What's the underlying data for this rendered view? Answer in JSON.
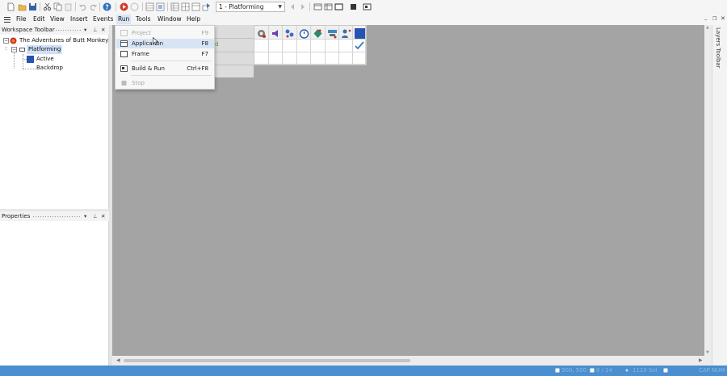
{
  "toolbar": {
    "frame_select_value": "1 - Platforming",
    "icons": [
      "new-file-icon",
      "open-folder-icon",
      "save-icon",
      "cut-icon",
      "copy-icon",
      "paste-icon",
      "undo-icon",
      "redo-icon",
      "help-icon",
      "run-icon",
      "stop-icon",
      "storyboard-icon",
      "frame-editor-icon",
      "event-editor-icon",
      "event-list-icon",
      "data-elements-icon",
      "pointer-icon",
      "previous-frame-icon",
      "next-frame-icon"
    ]
  },
  "menubar": {
    "items": [
      "File",
      "Edit",
      "View",
      "Insert",
      "Events",
      "Run",
      "Tools",
      "Window",
      "Help"
    ],
    "open_item": "Run"
  },
  "workspace": {
    "title": "Workspace Toolbar",
    "tree": {
      "app": "The Adventures of Butt Monkey *",
      "frame": "Platforming",
      "objects": [
        "Active",
        "Backdrop"
      ]
    }
  },
  "properties": {
    "title": "Properties"
  },
  "run_menu": {
    "items": [
      {
        "label": "Project",
        "shortcut": "F9",
        "disabled": true
      },
      {
        "label": "Application",
        "shortcut": "F8",
        "disabled": false,
        "highlighted": true
      },
      {
        "label": "Frame",
        "shortcut": "F7",
        "disabled": false
      },
      {
        "label": "Build & Run",
        "shortcut": "Ctrl+F8",
        "disabled": false
      },
      {
        "label": "Stop",
        "shortcut": "",
        "disabled": true
      }
    ]
  },
  "event_editor": {
    "partial_text": "d",
    "column_icons": [
      "special-conditions-icon",
      "sound-icon",
      "storyboard-controls-icon",
      "timer-icon",
      "create-object-icon",
      "mouse-keyboard-icon",
      "player-icon",
      "active-object-icon"
    ],
    "checked_cell": {
      "row": 1,
      "col": 8
    }
  },
  "layers": {
    "label": "Layers Toolbar"
  },
  "status_bar": {
    "items": [
      "900, 500",
      "0 / 14",
      "1110 Sol",
      "CAP NUM"
    ]
  },
  "colors": {
    "accent": "#4a8fd0",
    "canvas": "#a4a4a4",
    "highlight": "#d7e4f5"
  }
}
